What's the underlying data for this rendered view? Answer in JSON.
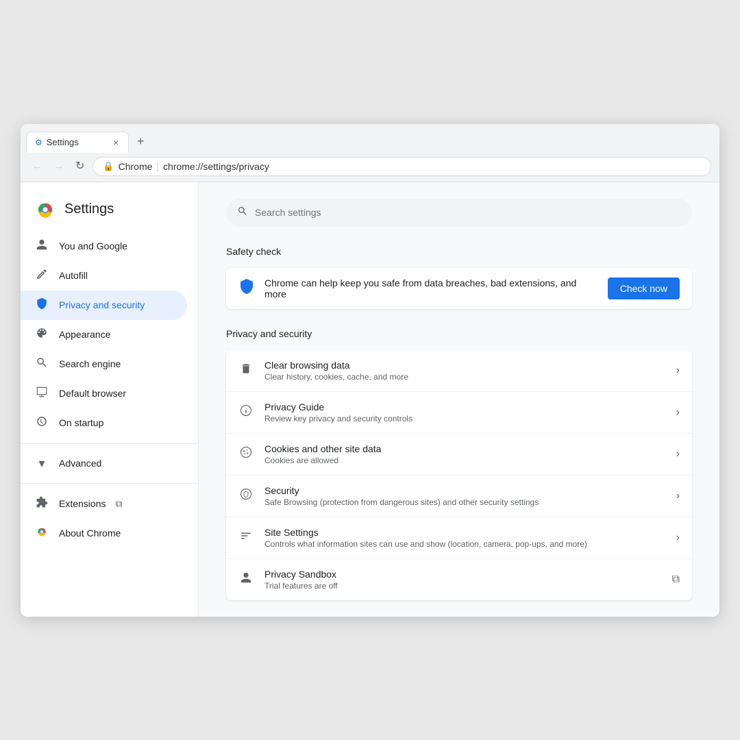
{
  "browser": {
    "tab_label": "Settings",
    "tab_favicon": "⚙",
    "tab_close": "×",
    "new_tab": "+",
    "nav_back": "←",
    "nav_forward": "→",
    "nav_refresh": "↻",
    "url_site": "Chrome",
    "url_full": "chrome://settings/privacy"
  },
  "sidebar": {
    "logo_text": "Settings",
    "items": [
      {
        "id": "you-and-google",
        "label": "You and Google",
        "icon": "👤",
        "active": false
      },
      {
        "id": "autofill",
        "label": "Autofill",
        "icon": "☰",
        "active": false
      },
      {
        "id": "privacy-security",
        "label": "Privacy and security",
        "icon": "🔵",
        "active": true
      },
      {
        "id": "appearance",
        "label": "Appearance",
        "icon": "⚙",
        "active": false
      },
      {
        "id": "search-engine",
        "label": "Search engine",
        "icon": "🔍",
        "active": false
      },
      {
        "id": "default-browser",
        "label": "Default browser",
        "icon": "⬜",
        "active": false
      },
      {
        "id": "on-startup",
        "label": "On startup",
        "icon": "⏻",
        "active": false
      }
    ],
    "advanced_label": "Advanced",
    "advanced_icon": "▾",
    "extensions_label": "Extensions",
    "extensions_icon": "🧩",
    "extensions_external_icon": "⧉",
    "about_chrome_label": "About Chrome",
    "about_chrome_icon": "ℹ"
  },
  "search": {
    "placeholder": "Search settings"
  },
  "safety_check": {
    "section_title": "Safety check",
    "icon": "🛡",
    "description": "Chrome can help keep you safe from data breaches, bad extensions, and more",
    "button_label": "Check now"
  },
  "privacy_security": {
    "section_title": "Privacy and security",
    "items": [
      {
        "id": "clear-browsing",
        "icon": "🗑",
        "title": "Clear browsing data",
        "subtitle": "Clear history, cookies, cache, and more",
        "arrow": "›",
        "external": false
      },
      {
        "id": "privacy-guide",
        "icon": "⊕",
        "title": "Privacy Guide",
        "subtitle": "Review key privacy and security controls",
        "arrow": "›",
        "external": false
      },
      {
        "id": "cookies",
        "icon": "🍪",
        "title": "Cookies and other site data",
        "subtitle": "Cookies are allowed",
        "arrow": "›",
        "external": false
      },
      {
        "id": "security",
        "icon": "🌐",
        "title": "Security",
        "subtitle": "Safe Browsing (protection from dangerous sites) and other security settings",
        "arrow": "›",
        "external": false
      },
      {
        "id": "site-settings",
        "icon": "≡",
        "title": "Site Settings",
        "subtitle": "Controls what information sites can use and show (location, camera, pop-ups, and more)",
        "arrow": "›",
        "external": false
      },
      {
        "id": "privacy-sandbox",
        "icon": "👤",
        "title": "Privacy Sandbox",
        "subtitle": "Trial features are off",
        "arrow": "⧉",
        "external": true
      }
    ]
  }
}
